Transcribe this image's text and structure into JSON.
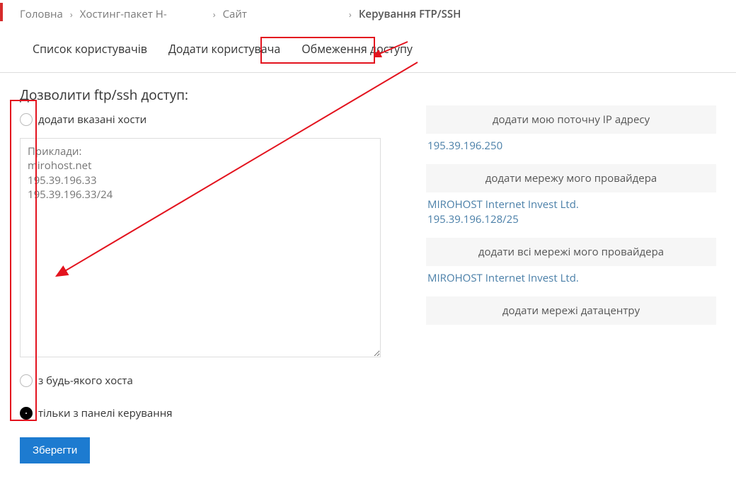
{
  "breadcrumbs": {
    "home": "Головна",
    "pkg_prefix": "Хостинг-пакет H-",
    "site_prefix": "Сайт",
    "current": "Керування FTP/SSH"
  },
  "tabs": {
    "list": "Список користувачів",
    "add": "Додати користувача",
    "restrict": "Обмеження доступу"
  },
  "section_title": "Дозволити ftp/ssh доступ:",
  "radios": {
    "hosts": "додати вказані хости",
    "any": "з будь-якого хоста",
    "panel": "тільки з панелі керування"
  },
  "textarea_placeholder": "Приклади:\nmirohost.net\n195.39.196.33\n195.39.196.33/24",
  "add_blocks": {
    "my_ip": {
      "title": "додати мою поточну IP адресу",
      "detail": "195.39.196.250"
    },
    "provider_net": {
      "title": "додати мережу мого провайдера",
      "detail": "MIROHOST Internet Invest Ltd.\n195.39.196.128/25"
    },
    "provider_all": {
      "title": "додати всі мережі мого провайдера",
      "detail": "MIROHOST Internet Invest Ltd."
    },
    "dc": {
      "title": "додати мережі датацентру",
      "detail": ""
    }
  },
  "save_label": "Зберегти"
}
